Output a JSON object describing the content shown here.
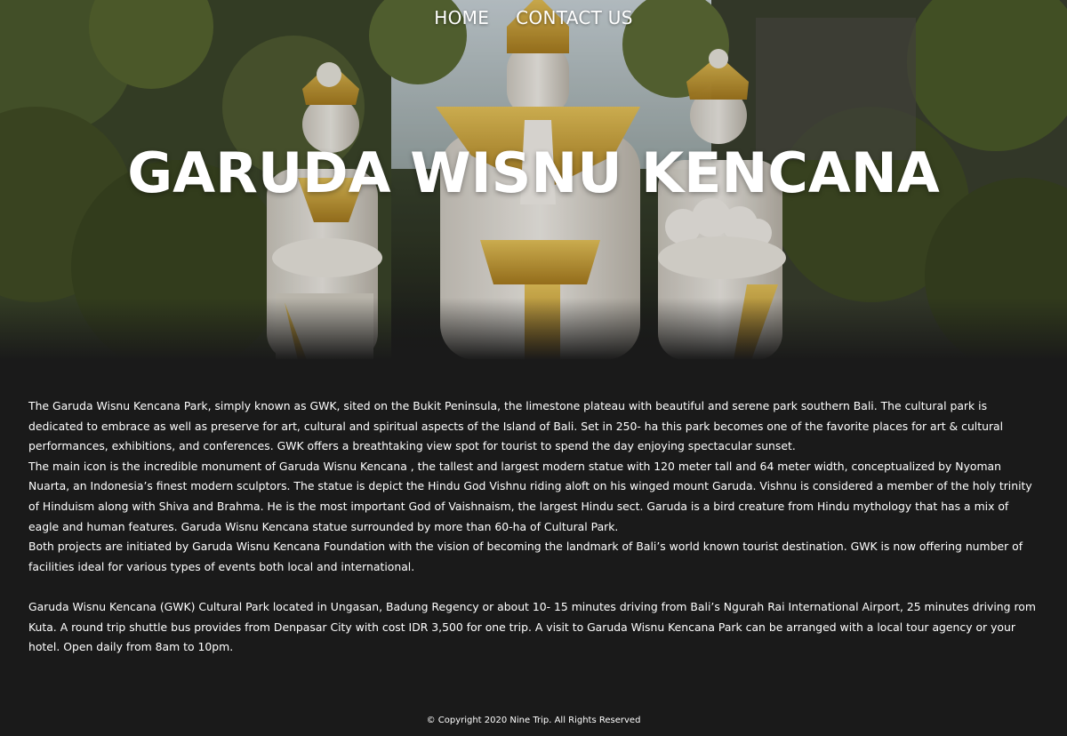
{
  "nav": {
    "items": [
      {
        "label": "HOME"
      },
      {
        "label": "CONTACT US"
      }
    ]
  },
  "hero": {
    "title": "GARUDA WISNU KENCANA"
  },
  "content": {
    "paragraphs": [
      "The Garuda Wisnu Kencana Park, simply known as GWK, sited on the Bukit Peninsula, the limestone plateau with beautiful and serene park southern Bali. The cultural park is dedicated to embrace as well as preserve for art, cultural and spiritual aspects of the Island of Bali. Set in 250- ha this park becomes one of the favorite places for art & cultural performances, exhibitions, and conferences. GWK offers a breathtaking view spot for tourist to spend the day enjoying spectacular sunset.",
      "The main icon is the incredible monument of Garuda Wisnu Kencana , the tallest and largest modern statue with 120 meter tall and 64 meter width, conceptualized by Nyoman Nuarta, an Indonesia’s finest modern sculptors. The statue is depict the Hindu God Vishnu riding aloft on his winged mount Garuda. Vishnu is considered a member of the holy trinity of Hinduism along with Shiva and Brahma. He is the most important God of Vaishnaism, the largest Hindu sect. Garuda is a bird creature from Hindu mythology that has a mix of eagle and human features. Garuda Wisnu Kencana statue surrounded by more than 60-ha of Cultural Park.",
      "Both projects are initiated by Garuda Wisnu Kencana Foundation with the vision of becoming the landmark of Bali’s world known tourist destination. GWK is now offering number of facilities ideal for various types of events both local and international.",
      "Garuda Wisnu Kencana (GWK) Cultural Park located in Ungasan, Badung Regency or about 10- 15 minutes driving from Bali’s Ngurah Rai International Airport, 25 minutes driving rom Kuta. A round trip shuttle bus provides from Denpasar City with cost IDR 3,500 for one trip. A visit to Garuda Wisnu Kencana Park can be arranged with a local tour agency or your hotel. Open daily from 8am to 10pm."
    ]
  },
  "footer": {
    "copyright": "© Copyright 2020 Nine Trip. All Rights Reserved"
  },
  "colors": {
    "background": "#1a1a1a",
    "text": "#ffffff",
    "gold": "#c9a227",
    "statue_white": "#e8e4dc"
  }
}
